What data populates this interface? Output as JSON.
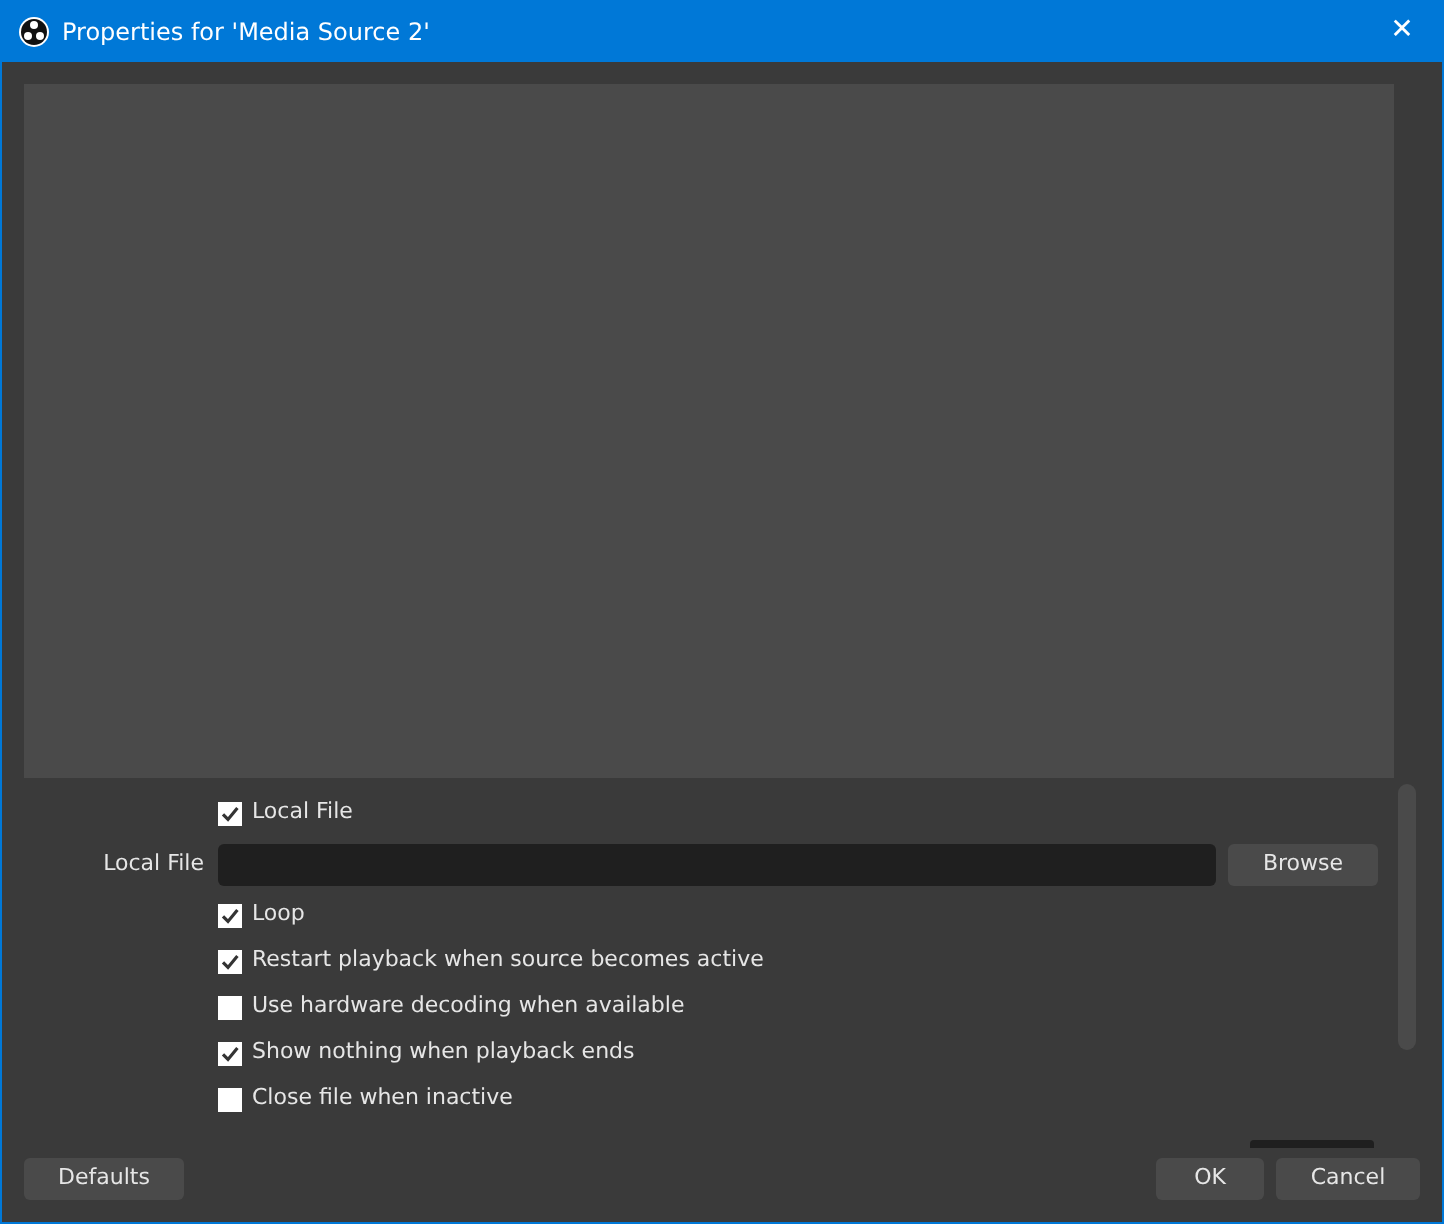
{
  "window": {
    "title": "Properties for 'Media Source 2'",
    "close": "✕"
  },
  "properties": [
    {
      "kind": "checkbox",
      "label": "Local File",
      "checked": true
    },
    {
      "kind": "file",
      "label": "Local File",
      "button": "Browse"
    },
    {
      "kind": "checkbox",
      "label": "Loop",
      "checked": true
    },
    {
      "kind": "checkbox",
      "label": "Restart playback when source becomes active",
      "checked": true
    },
    {
      "kind": "checkbox",
      "label": "Use hardware decoding when available",
      "checked": false
    },
    {
      "kind": "checkbox",
      "label": "Show nothing when playback ends",
      "checked": true
    },
    {
      "kind": "checkbox",
      "label": "Close file when inactive",
      "checked": false
    }
  ],
  "buttons": {
    "defaults": "Defaults",
    "ok": "OK",
    "cancel": "Cancel"
  }
}
